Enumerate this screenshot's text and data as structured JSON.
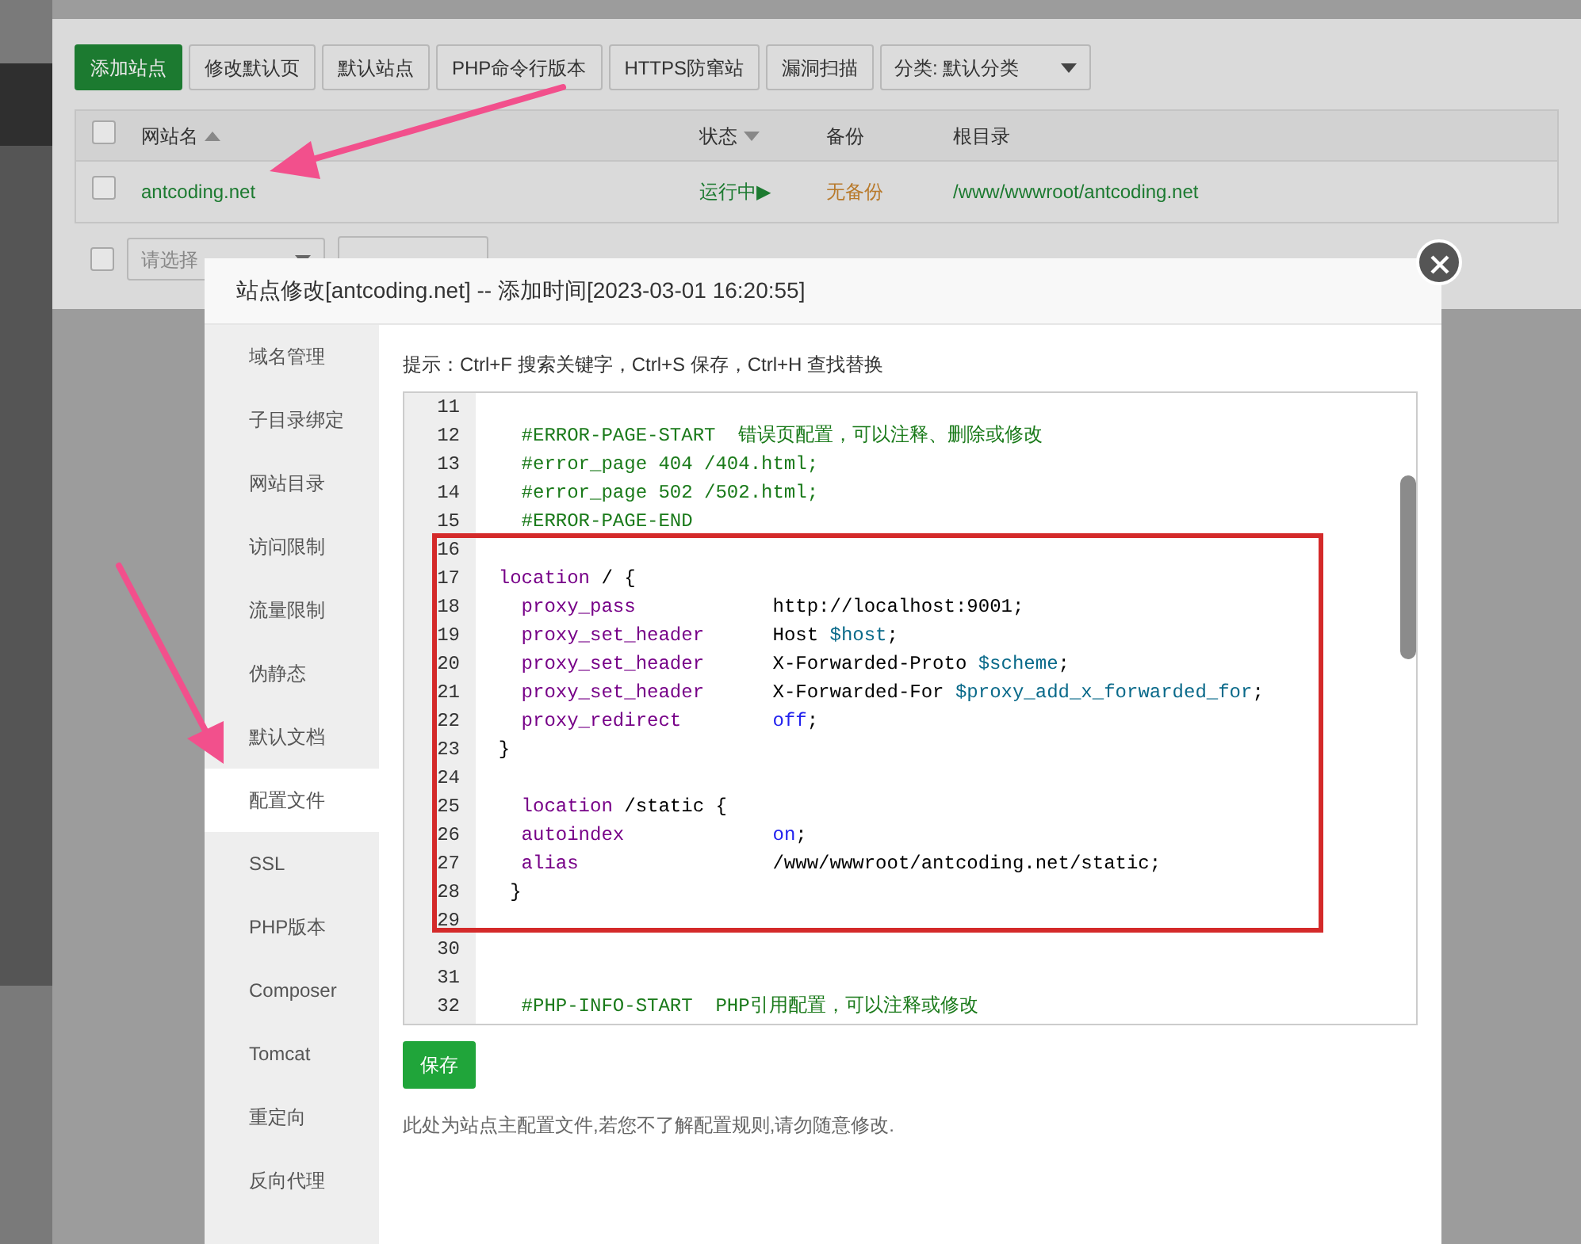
{
  "toolbar": {
    "buttons": [
      {
        "label": "添加站点",
        "kind": "primary"
      },
      {
        "label": "修改默认页",
        "kind": "default"
      },
      {
        "label": "默认站点",
        "kind": "default"
      },
      {
        "label": "PHP命令行版本",
        "kind": "default"
      },
      {
        "label": "HTTPS防窜站",
        "kind": "default"
      },
      {
        "label": "漏洞扫描",
        "kind": "default"
      }
    ],
    "category_select": {
      "value": "分类: 默认分类"
    }
  },
  "table": {
    "header_checked": false,
    "columns": [
      {
        "label": "网站名",
        "sortable": true
      },
      {
        "label": "状态",
        "sortable": true
      },
      {
        "label": "备份",
        "sortable": false
      },
      {
        "label": "根目录",
        "sortable": false
      }
    ],
    "rows": [
      {
        "checked": false,
        "name": "antcoding.net",
        "status": "运行中▶",
        "backup": "无备份",
        "root": "/www/wwwroot/antcoding.net"
      }
    ]
  },
  "batch": {
    "checked": false,
    "select_placeholder": "请选择"
  },
  "dialog": {
    "title": "站点修改[antcoding.net] -- 添加时间[2023-03-01 16:20:55]",
    "nav": [
      {
        "label": "域名管理",
        "selected": false
      },
      {
        "label": "子目录绑定",
        "selected": false
      },
      {
        "label": "网站目录",
        "selected": false
      },
      {
        "label": "访问限制",
        "selected": false
      },
      {
        "label": "流量限制",
        "selected": false
      },
      {
        "label": "伪静态",
        "selected": false
      },
      {
        "label": "默认文档",
        "selected": false
      },
      {
        "label": "配置文件",
        "selected": true
      },
      {
        "label": "SSL",
        "selected": false
      },
      {
        "label": "PHP版本",
        "selected": false
      },
      {
        "label": "Composer",
        "selected": false
      },
      {
        "label": "Tomcat",
        "selected": false
      },
      {
        "label": "重定向",
        "selected": false
      },
      {
        "label": "反向代理",
        "selected": false
      }
    ],
    "hint": "提示：Ctrl+F 搜索关键字，Ctrl+S 保存，Ctrl+H 查找替换",
    "editor": {
      "lines": [
        {
          "number": "11"
        },
        {
          "number": "12",
          "tokens": [
            {
              "kind": "comment",
              "text": "    #ERROR-PAGE-START  错误页配置，可以注释、删除或修改"
            }
          ]
        },
        {
          "number": "13",
          "tokens": [
            {
              "kind": "comment",
              "text": "    #error_page 404 /404.html;"
            }
          ]
        },
        {
          "number": "14",
          "tokens": [
            {
              "kind": "comment",
              "text": "    #error_page 502 /502.html;"
            }
          ]
        },
        {
          "number": "15",
          "tokens": [
            {
              "kind": "comment",
              "text": "    #ERROR-PAGE-END"
            }
          ]
        },
        {
          "number": "16"
        },
        {
          "number": "17",
          "tokens": [
            {
              "kind": "keyword",
              "text": "  location"
            },
            {
              "kind": "plain",
              "text": " / {"
            }
          ]
        },
        {
          "number": "18",
          "tokens": [
            {
              "kind": "keyword",
              "text": "    proxy_pass"
            },
            {
              "kind": "plain",
              "text": "            http://localhost:9001;"
            }
          ]
        },
        {
          "number": "19",
          "tokens": [
            {
              "kind": "keyword",
              "text": "    proxy_set_header"
            },
            {
              "kind": "plain",
              "text": "      Host "
            },
            {
              "kind": "variable",
              "text": "$host"
            },
            {
              "kind": "plain",
              "text": ";"
            }
          ]
        },
        {
          "number": "20",
          "tokens": [
            {
              "kind": "keyword",
              "text": "    proxy_set_header"
            },
            {
              "kind": "plain",
              "text": "      X-Forwarded-Proto "
            },
            {
              "kind": "variable",
              "text": "$scheme"
            },
            {
              "kind": "plain",
              "text": ";"
            }
          ]
        },
        {
          "number": "21",
          "tokens": [
            {
              "kind": "keyword",
              "text": "    proxy_set_header"
            },
            {
              "kind": "plain",
              "text": "      X-Forwarded-For "
            },
            {
              "kind": "variable",
              "text": "$proxy_add_x_forwarded_for"
            },
            {
              "kind": "plain",
              "text": ";"
            }
          ]
        },
        {
          "number": "22",
          "tokens": [
            {
              "kind": "keyword",
              "text": "    proxy_redirect"
            },
            {
              "kind": "atom",
              "text": "        off"
            },
            {
              "kind": "plain",
              "text": ";"
            }
          ]
        },
        {
          "number": "23",
          "tokens": [
            {
              "kind": "plain",
              "text": "  }"
            }
          ]
        },
        {
          "number": "24"
        },
        {
          "number": "25",
          "tokens": [
            {
              "kind": "keyword",
              "text": "    location"
            },
            {
              "kind": "plain",
              "text": " /static {"
            }
          ]
        },
        {
          "number": "26",
          "tokens": [
            {
              "kind": "keyword",
              "text": "    autoindex"
            },
            {
              "kind": "atom",
              "text": "             on"
            },
            {
              "kind": "plain",
              "text": ";"
            }
          ]
        },
        {
          "number": "27",
          "tokens": [
            {
              "kind": "keyword",
              "text": "    alias"
            },
            {
              "kind": "plain",
              "text": "                 /www/wwwroot/antcoding.net/static;"
            }
          ]
        },
        {
          "number": "28",
          "tokens": [
            {
              "kind": "plain",
              "text": "   }"
            }
          ]
        },
        {
          "number": "29"
        },
        {
          "number": "30"
        },
        {
          "number": "31"
        },
        {
          "number": "32",
          "tokens": [
            {
              "kind": "comment",
              "text": "    #PHP-INFO-START  PHP引用配置，可以注释或修改"
            }
          ]
        }
      ]
    },
    "save_button": "保存",
    "note": "此处为站点主配置文件,若您不了解配置规则,请勿随意修改."
  }
}
